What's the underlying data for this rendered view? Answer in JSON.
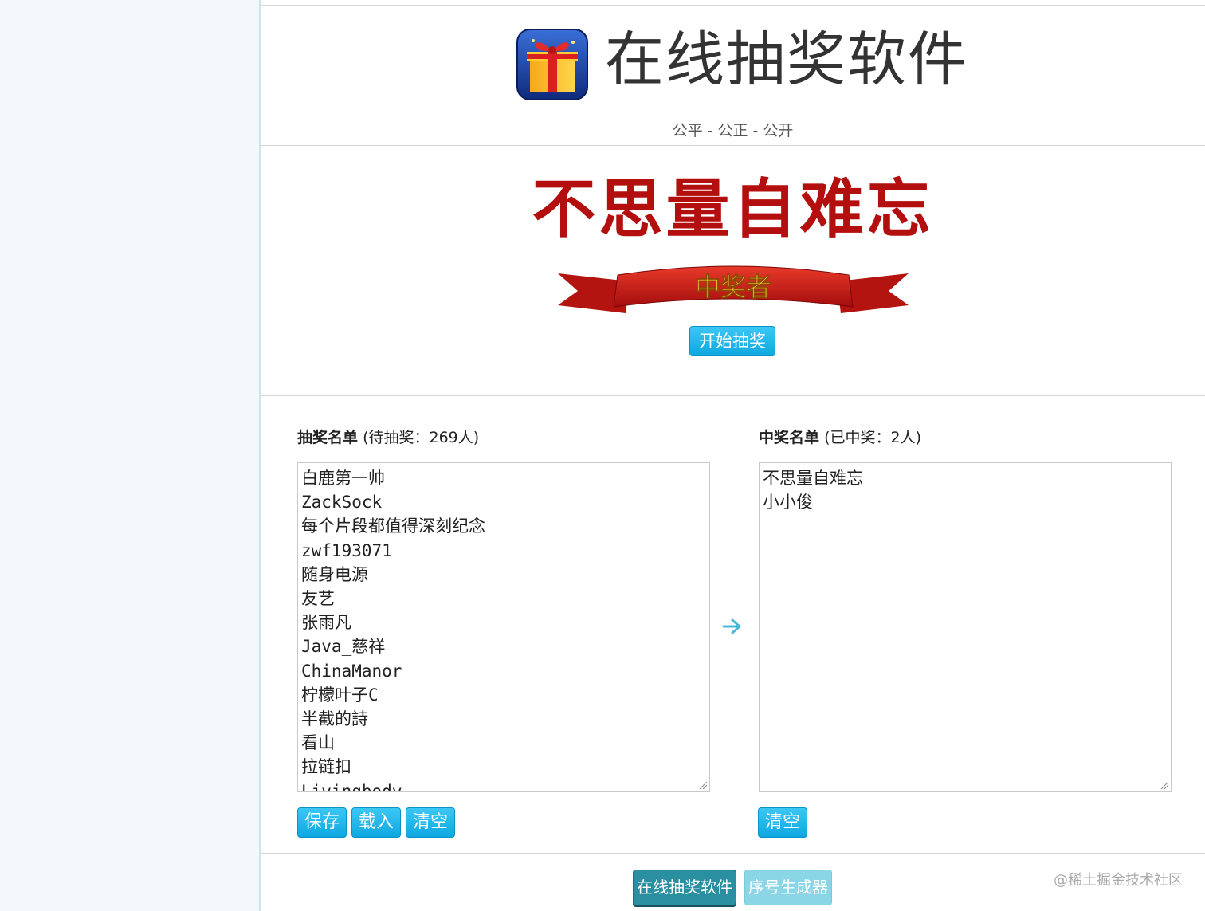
{
  "header": {
    "title": "在线抽奖软件",
    "slogan": "公平 - 公正 - 公开",
    "logo_icon": "gift-box-icon"
  },
  "display": {
    "current_winner": "不思量自难忘",
    "ribbon_text": "中奖者",
    "start_button": "开始抽奖"
  },
  "pool": {
    "label_bold": "抽奖名单",
    "label_count": "(待抽奖：269人)",
    "entries": [
      "白鹿第一帅",
      "ZackSock",
      "每个片段都值得深刻纪念",
      "zwf193071",
      "随身电源",
      "友艺",
      "张雨凡",
      "Java_慈祥",
      "ChinaManor",
      "柠檬叶子C",
      "半截的詩",
      "看山",
      "拉链扣",
      "Livingbody"
    ],
    "buttons": {
      "save": "保存",
      "load": "载入",
      "clear": "清空"
    }
  },
  "winners": {
    "label_bold": "中奖名单",
    "label_count": "(已中奖：2人)",
    "entries": [
      "不思量自难忘",
      "小小俊"
    ],
    "buttons": {
      "clear": "清空"
    }
  },
  "transfer_icon": "arrow-right-icon",
  "footer_nav": {
    "lottery": "在线抽奖软件",
    "serial_generator": "序号生成器"
  },
  "watermark": "@稀土掘金技术社区",
  "colors": {
    "accent_blue": "#1ab3ea",
    "winner_red": "#b40f0f",
    "nav_active": "#2a8fa0",
    "nav_inactive": "#8ad6e6"
  }
}
